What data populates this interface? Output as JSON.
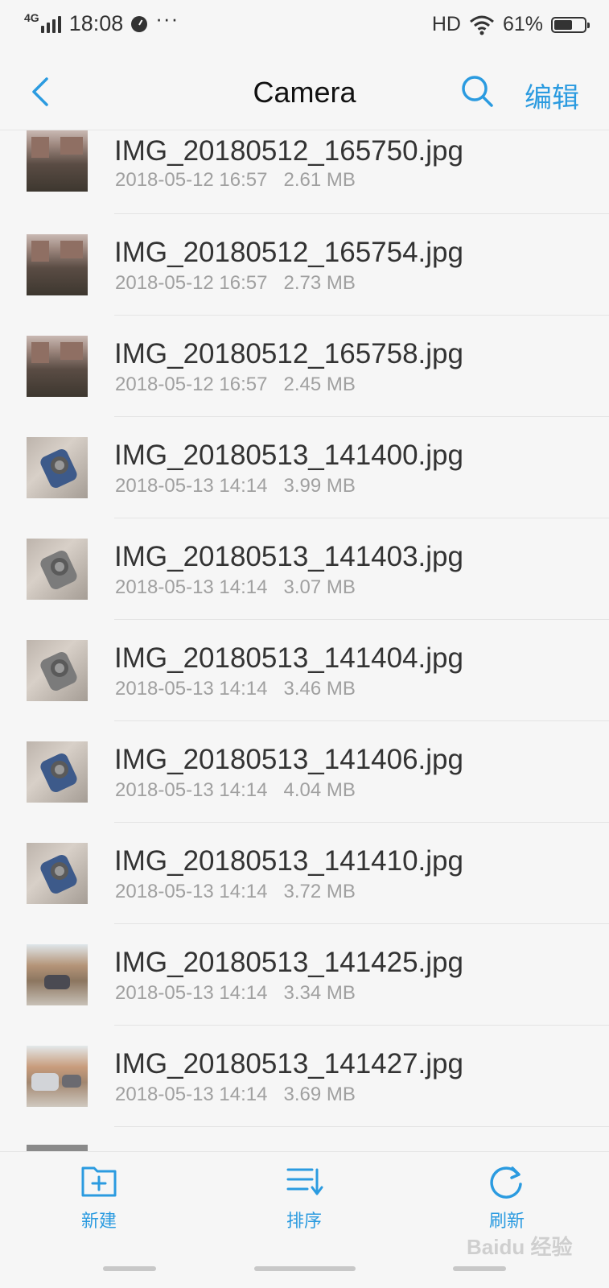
{
  "status_bar": {
    "network": "4G",
    "time": "18:08",
    "more": "···",
    "hd": "HD",
    "battery_percent": "61%",
    "battery_level": 0.61,
    "icons": [
      "signal-icon",
      "clock-icon",
      "wifi-icon",
      "battery-icon"
    ]
  },
  "header": {
    "title": "Camera",
    "edit_label": "编辑",
    "icons": [
      "back-icon",
      "search-icon"
    ],
    "accent_color": "#2b9be0"
  },
  "files": [
    {
      "name": "IMG_20180512_165750.jpg",
      "date": "2018-05-12 16:57",
      "size": "2.61 MB",
      "thumb": "building"
    },
    {
      "name": "IMG_20180512_165754.jpg",
      "date": "2018-05-12 16:57",
      "size": "2.73 MB",
      "thumb": "building"
    },
    {
      "name": "IMG_20180512_165758.jpg",
      "date": "2018-05-12 16:57",
      "size": "2.45 MB",
      "thumb": "building"
    },
    {
      "name": "IMG_20180513_141400.jpg",
      "date": "2018-05-13 14:14",
      "size": "3.99 MB",
      "thumb": "filter-blue"
    },
    {
      "name": "IMG_20180513_141403.jpg",
      "date": "2018-05-13 14:14",
      "size": "3.07 MB",
      "thumb": "filter-gray"
    },
    {
      "name": "IMG_20180513_141404.jpg",
      "date": "2018-05-13 14:14",
      "size": "3.46 MB",
      "thumb": "filter-gray"
    },
    {
      "name": "IMG_20180513_141406.jpg",
      "date": "2018-05-13 14:14",
      "size": "4.04 MB",
      "thumb": "filter-blue"
    },
    {
      "name": "IMG_20180513_141410.jpg",
      "date": "2018-05-13 14:14",
      "size": "3.72 MB",
      "thumb": "filter-blue"
    },
    {
      "name": "IMG_20180513_141425.jpg",
      "date": "2018-05-13 14:14",
      "size": "3.34 MB",
      "thumb": "yard"
    },
    {
      "name": "IMG_20180513_141427.jpg",
      "date": "2018-05-13 14:14",
      "size": "3.69 MB",
      "thumb": "yard2"
    }
  ],
  "bottom_bar": {
    "new_label": "新建",
    "sort_label": "排序",
    "refresh_label": "刷新",
    "icons": [
      "new-folder-icon",
      "sort-icon",
      "refresh-icon"
    ]
  },
  "watermark": "Baidu 经验"
}
